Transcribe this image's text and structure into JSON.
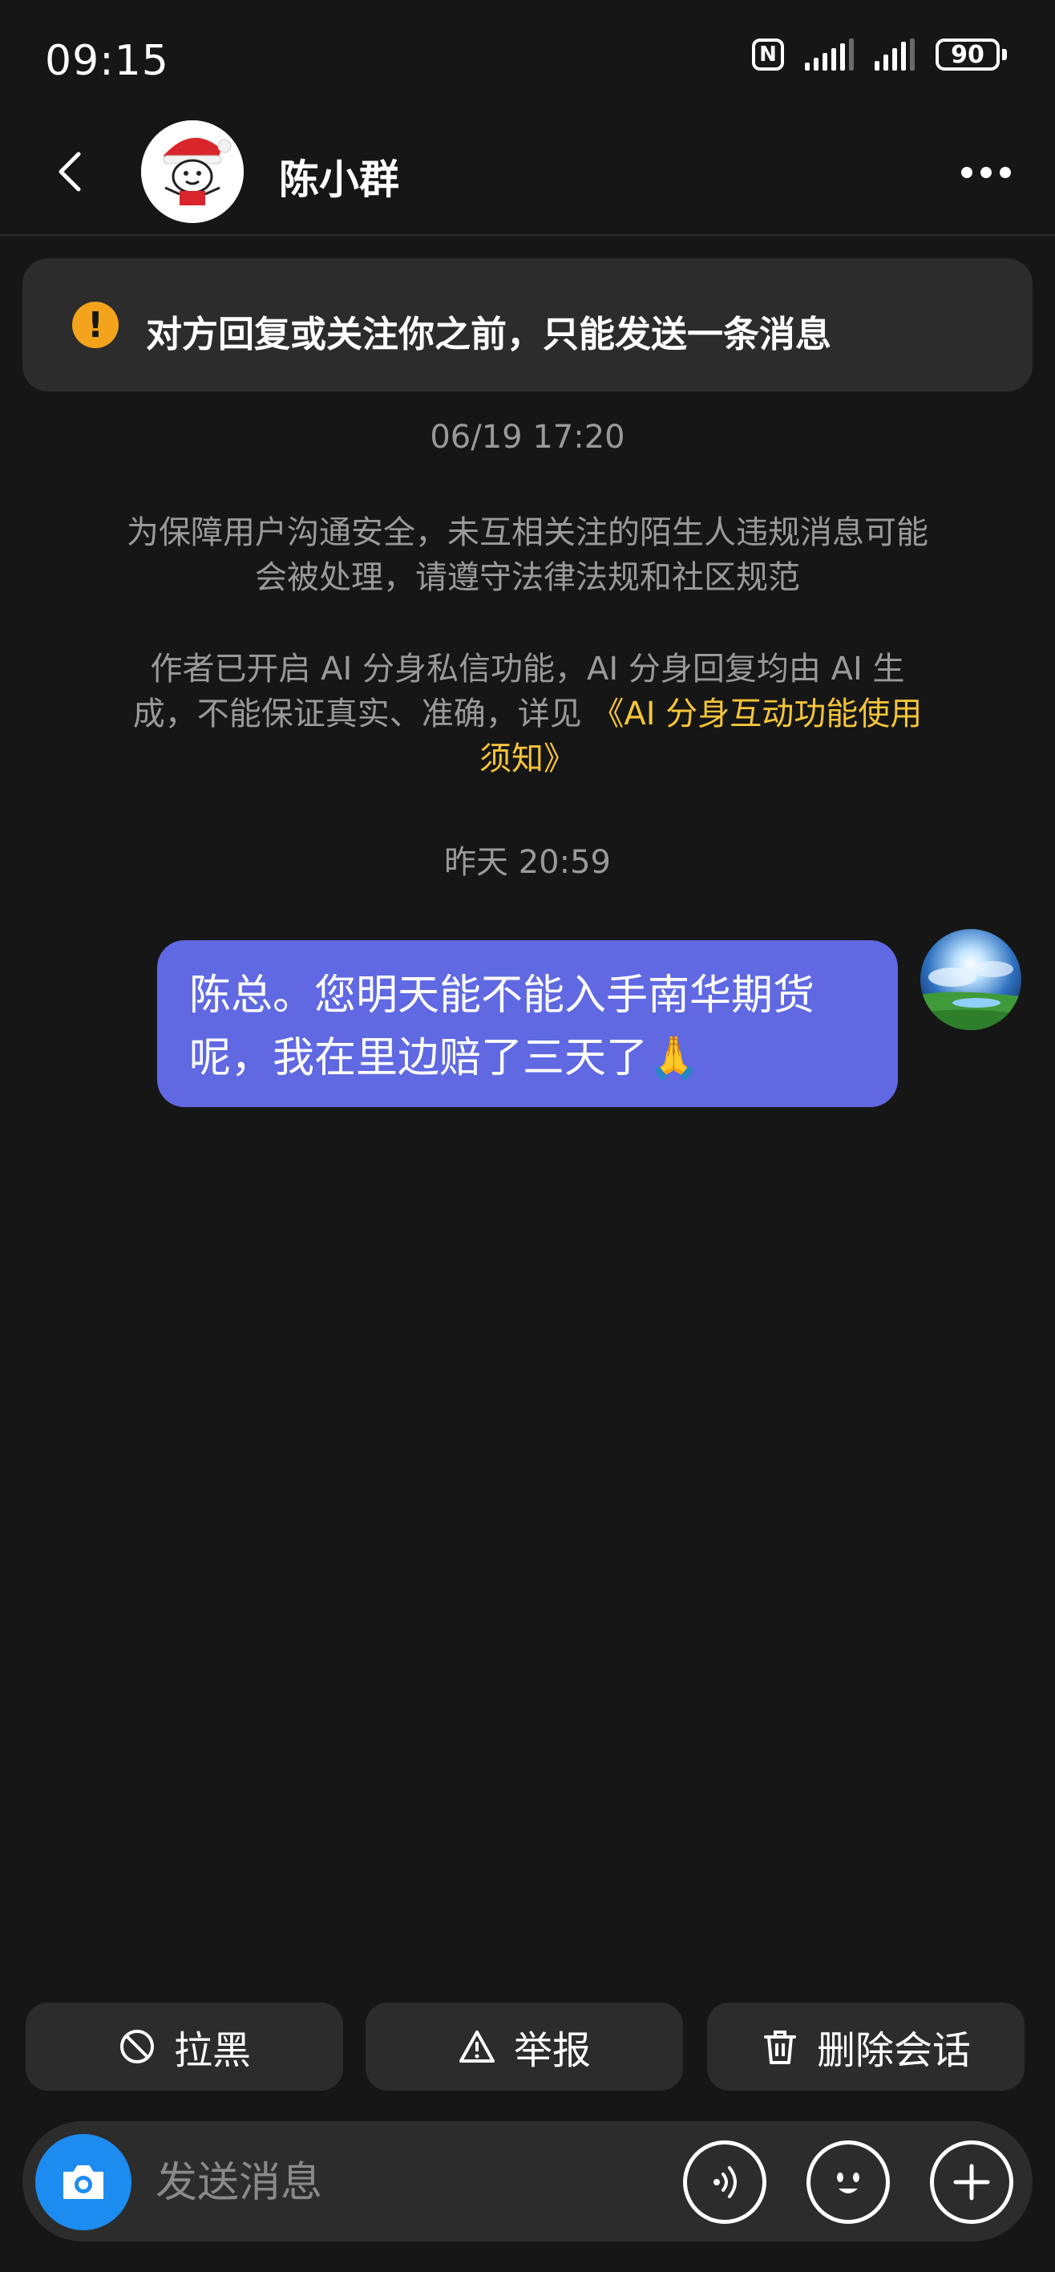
{
  "status_bar": {
    "time": "09:15",
    "nfc_label": "N",
    "battery": "90",
    "icons": [
      "nfc-icon",
      "signal-icon",
      "signal-icon",
      "battery-icon"
    ]
  },
  "header": {
    "back_icon": "chevron-left-icon",
    "contact_name": "陈小群",
    "more_icon": "more-horizontal-icon"
  },
  "notice": {
    "icon": "exclamation-icon",
    "accent": "#f3a41c",
    "text": "对方回复或关注你之前，只能发送一条消息"
  },
  "conversation": {
    "timestamp_1": "06/19 17:20",
    "system_notice_1": "为保障用户沟通安全，未互相关注的陌生人违规消息可能会被处理，请遵守法律法规和社区规范",
    "system_notice_2_prefix": "作者已开启 AI 分身私信功能，AI 分身回复均由 AI 生成，不能保证真实、准确，详见",
    "system_notice_2_link": "《AI 分身互动功能使用须知》",
    "link_color": "#f5c53a",
    "timestamp_2": "昨天 20:59",
    "messages": [
      {
        "from": "me",
        "text": "陈总。您明天能不能入手南华期货呢，我在里边赔了三天了🙏",
        "bubble_color": "#6069e2"
      }
    ]
  },
  "actions": {
    "block_label": "拉黑",
    "block_icon": "block-icon",
    "report_label": "举报",
    "report_icon": "warning-triangle-icon",
    "delete_label": "删除会话",
    "delete_icon": "trash-icon"
  },
  "input_bar": {
    "placeholder": "发送消息",
    "camera_icon": "camera-icon",
    "voice_icon": "voice-icon",
    "emoji_icon": "emoji-icon",
    "plus_icon": "plus-icon",
    "camera_color": "#1d8cf0"
  }
}
